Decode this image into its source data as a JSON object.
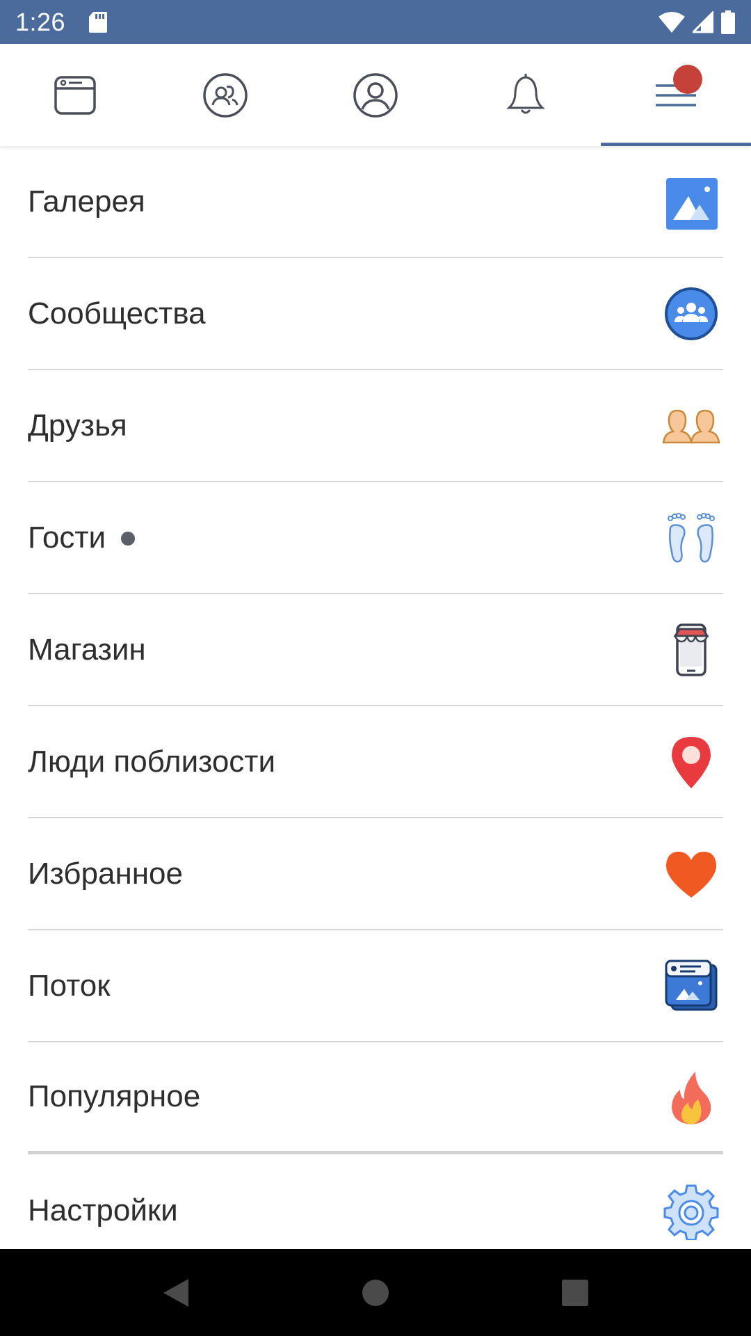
{
  "status_bar": {
    "time": "1:26"
  },
  "tabs": [
    {
      "icon": "feed-icon"
    },
    {
      "icon": "friends-circle-icon"
    },
    {
      "icon": "profile-icon"
    },
    {
      "icon": "bell-icon"
    },
    {
      "icon": "menu-icon",
      "active": true,
      "has_notification": true
    }
  ],
  "menu": {
    "items": [
      {
        "label": "Галерея",
        "icon": "gallery-icon"
      },
      {
        "label": "Сообщества",
        "icon": "communities-icon"
      },
      {
        "label": "Друзья",
        "icon": "friends-icon"
      },
      {
        "label": "Гости",
        "icon": "footprints-icon",
        "has_dot": true
      },
      {
        "label": "Магазин",
        "icon": "shop-icon"
      },
      {
        "label": "Люди поблизости",
        "icon": "location-pin-icon"
      },
      {
        "label": "Избранное",
        "icon": "heart-icon"
      },
      {
        "label": "Поток",
        "icon": "stream-icon"
      },
      {
        "label": "Популярное",
        "icon": "fire-icon"
      },
      {
        "label": "Настройки",
        "icon": "settings-gear-icon"
      }
    ]
  },
  "colors": {
    "brand": "#4a6b9b",
    "notification": "#c5423a"
  }
}
